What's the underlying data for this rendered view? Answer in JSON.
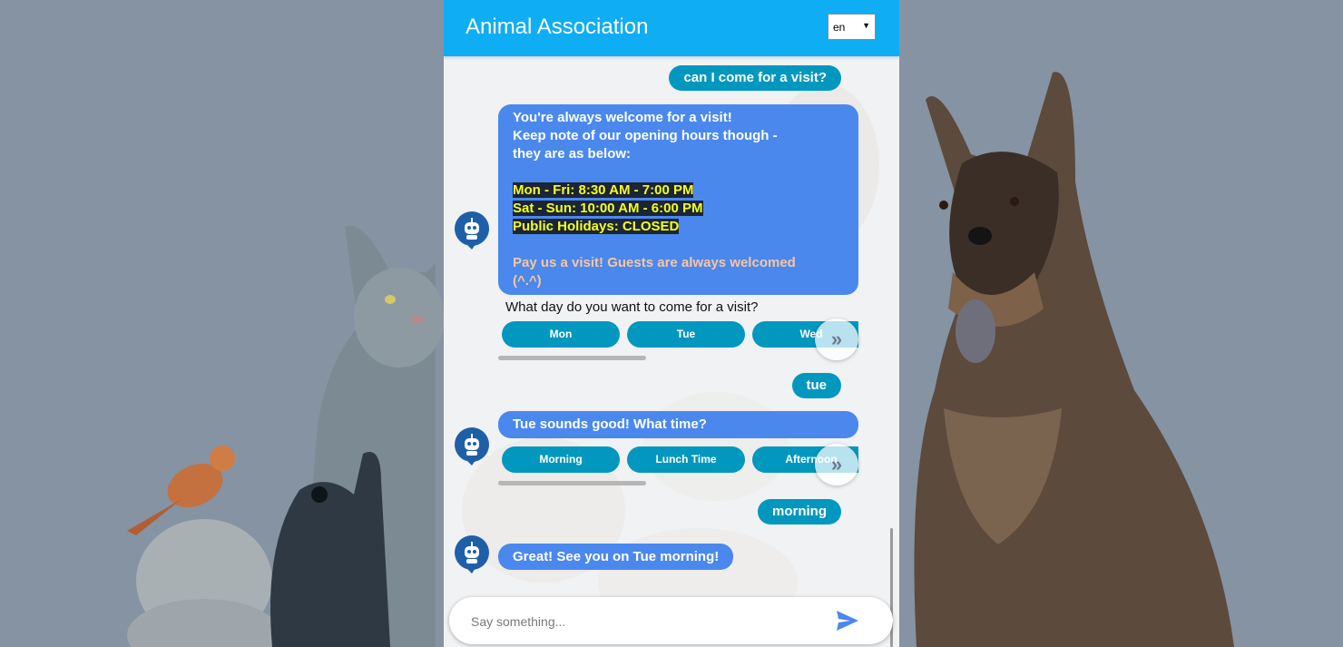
{
  "header": {
    "title": "Animal Association",
    "language": "en"
  },
  "messages": [
    {
      "from": "user",
      "text": "can I come for a visit?"
    },
    {
      "from": "bot",
      "lines": [
        "You're always welcome for a visit!",
        "Keep note of our opening hours though -",
        "they are as below:",
        "Mon - Fri: 8:30 AM - 7:00 PM",
        "Sat - Sun: 10:00 AM - 6:00 PM",
        "Public Holidays: CLOSED",
        "Pay us a visit! Guests are always welcomed",
        "(^.^)"
      ],
      "question": "What day do you want to come for a visit?",
      "quick_replies": [
        "Mon",
        "Tue",
        "Wed"
      ]
    },
    {
      "from": "user",
      "text": "tue"
    },
    {
      "from": "bot",
      "text": "Tue sounds good! What time?",
      "quick_replies": [
        "Morning",
        "Lunch Time",
        "Afternoon"
      ]
    },
    {
      "from": "user",
      "text": "morning"
    },
    {
      "from": "bot",
      "text": "Great! See you on Tue morning!"
    }
  ],
  "composer": {
    "placeholder": "Say something..."
  },
  "icons": {
    "more": "double-chevron-right-icon",
    "send": "send-icon",
    "bot": "robot-avatar-icon"
  },
  "colors": {
    "header": "#0fadf3",
    "user_bubble": "#0297be",
    "bot_bubble": "#4a88ee",
    "highlight_text": "#f4ff1f",
    "send_icon": "#4a88ee"
  }
}
